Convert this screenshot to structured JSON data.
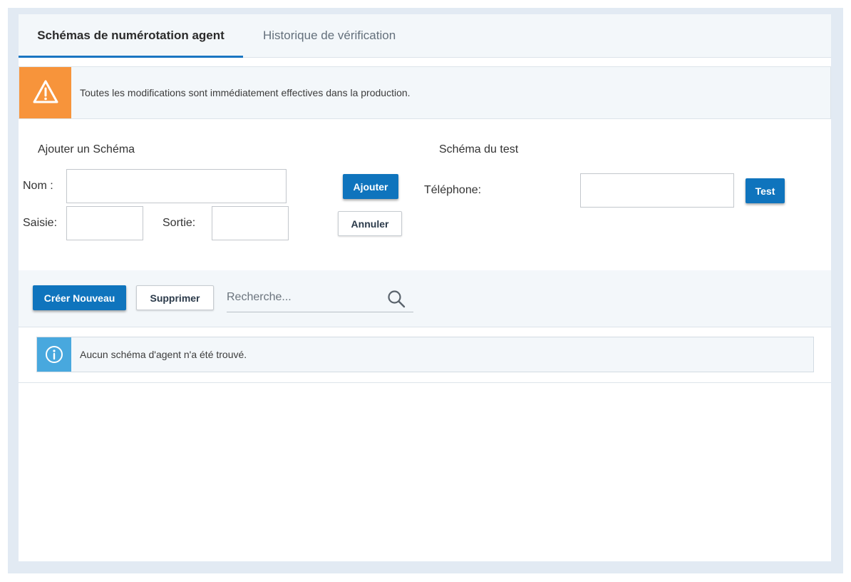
{
  "tabs": [
    {
      "label": "Schémas de numérotation agent",
      "active": true
    },
    {
      "label": "Historique de vérification",
      "active": false
    }
  ],
  "warning": {
    "icon": "warning-triangle-icon",
    "text": "Toutes les modifications sont immédiatement effectives dans la production.",
    "color": "#f7943b"
  },
  "add_schema": {
    "title": "Ajouter un Schéma",
    "name_label": "Nom :",
    "name_value": "",
    "input_label": "Saisie:",
    "input_value": "",
    "output_label": "Sortie:",
    "output_value": "",
    "add_button": "Ajouter",
    "cancel_button": "Annuler"
  },
  "test_schema": {
    "title": "Schéma du test",
    "phone_label": "Téléphone:",
    "phone_value": "",
    "test_button": "Test"
  },
  "toolbar": {
    "create_button": "Créer Nouveau",
    "delete_button": "Supprimer",
    "search_placeholder": "Recherche...",
    "search_icon": "search-icon"
  },
  "info": {
    "icon": "info-icon",
    "text": "Aucun schéma d'agent n'a été trouvé.",
    "color": "#48a8de"
  },
  "colors": {
    "accent": "#0f74bd",
    "tab_underline": "#1a76c2",
    "frame": "#e2eaf3"
  }
}
